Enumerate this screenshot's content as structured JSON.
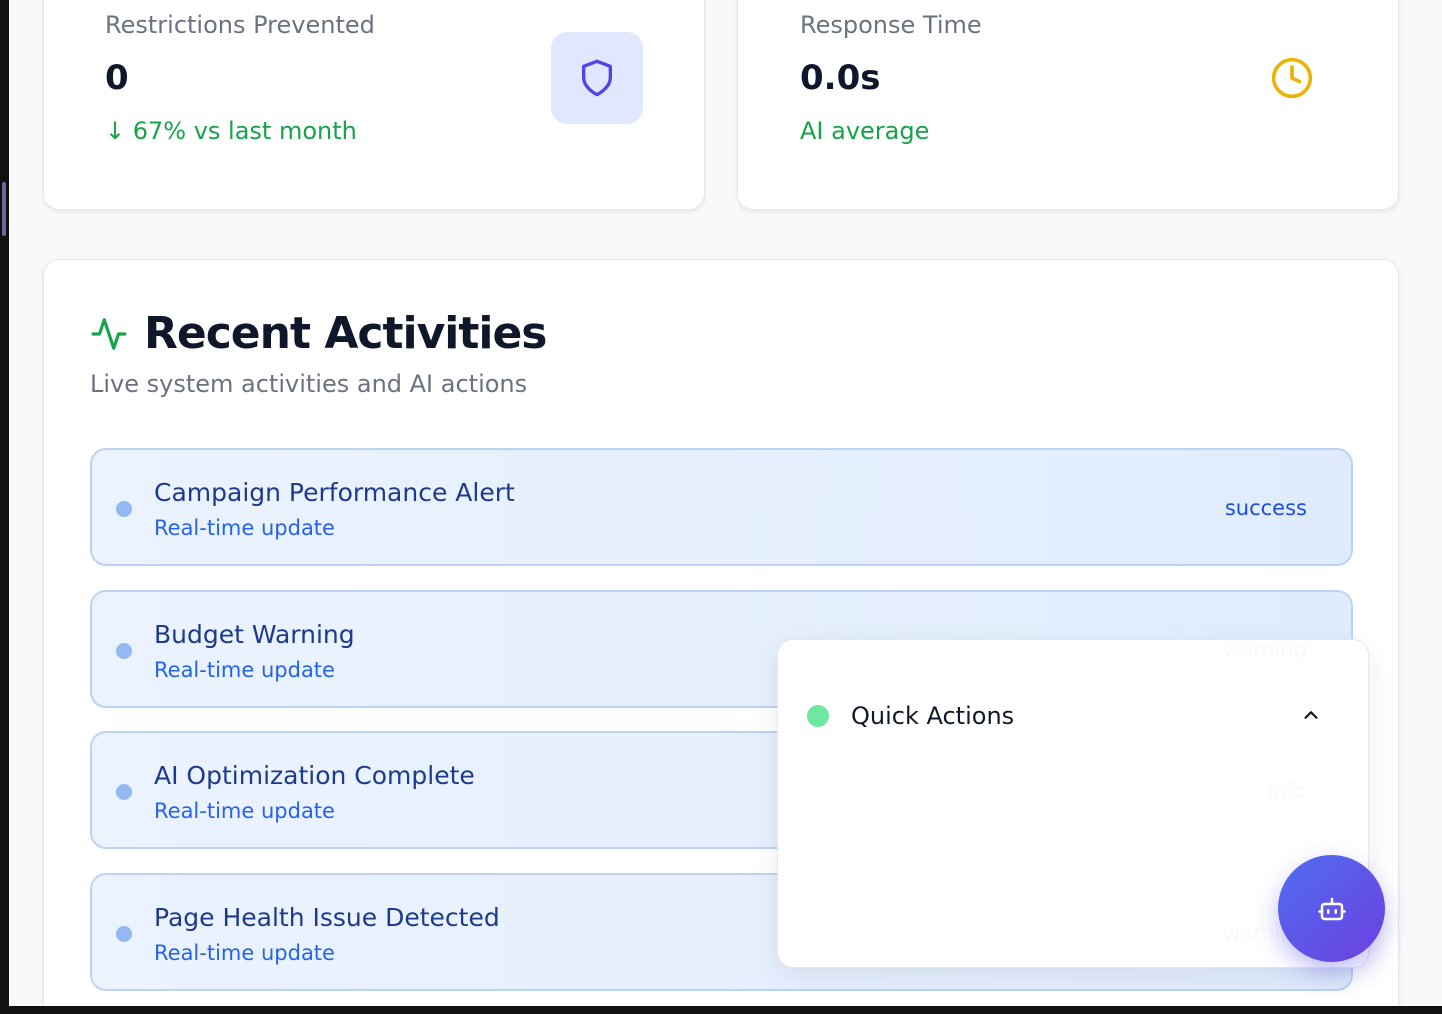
{
  "stats": [
    {
      "label": "Restrictions Prevented",
      "value": "0",
      "sub": "↓ 67% vs last month",
      "icon": "shield-icon"
    },
    {
      "label": "Response Time",
      "value": "0.0s",
      "sub": "AI average",
      "icon": "clock-icon"
    }
  ],
  "activities": {
    "title": "Recent Activities",
    "subtitle": "Live system activities and AI actions",
    "icon": "activity-pulse-icon",
    "items": [
      {
        "title": "Campaign Performance Alert",
        "meta": "Real-time update",
        "status": "success"
      },
      {
        "title": "Budget Warning",
        "meta": "Real-time update",
        "status": "warning"
      },
      {
        "title": "AI Optimization Complete",
        "meta": "Real-time update",
        "status": "info"
      },
      {
        "title": "Page Health Issue Detected",
        "meta": "Real-time update",
        "status": "warning"
      }
    ]
  },
  "quick_actions": {
    "title": "Quick Actions",
    "expanded": true
  },
  "fab": {
    "icon": "bot-icon"
  },
  "colors": {
    "success_text": "#16a34a",
    "shield_bg": "#e0e7ff",
    "shield_stroke": "#4f46e5",
    "clock_stroke": "#eab308",
    "pulse_stroke": "#16a34a",
    "fab_gradient_start": "#4f6ef0",
    "fab_gradient_end": "#6d3fe0"
  }
}
